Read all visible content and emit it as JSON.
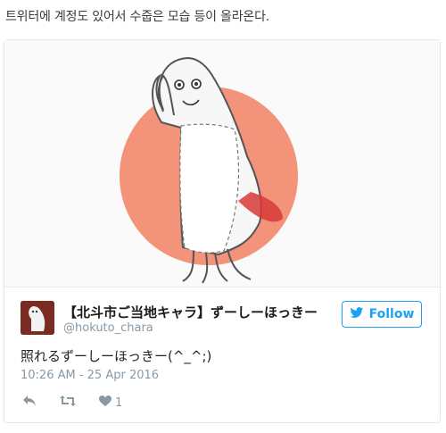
{
  "caption": "트위터에 계정도 있어서 수줍은 모습 등이 올라온다.",
  "tweet": {
    "display_name": "【北斗市ご当地キャラ】ずーしーほっきー",
    "handle": "@hokuto_chara",
    "follow_label": "Follow",
    "text": "照れるずーしーほっきー(^_^;)",
    "timestamp": "10:26 AM - 25 Apr 2016",
    "like_count": "1"
  },
  "icons": {
    "reply": "reply-icon",
    "retweet": "retweet-icon",
    "like": "heart-icon",
    "follow": "twitter-bird-icon"
  },
  "colors": {
    "accent": "#1da1f2",
    "sun": "#f2937a",
    "muted": "#8899a6"
  }
}
